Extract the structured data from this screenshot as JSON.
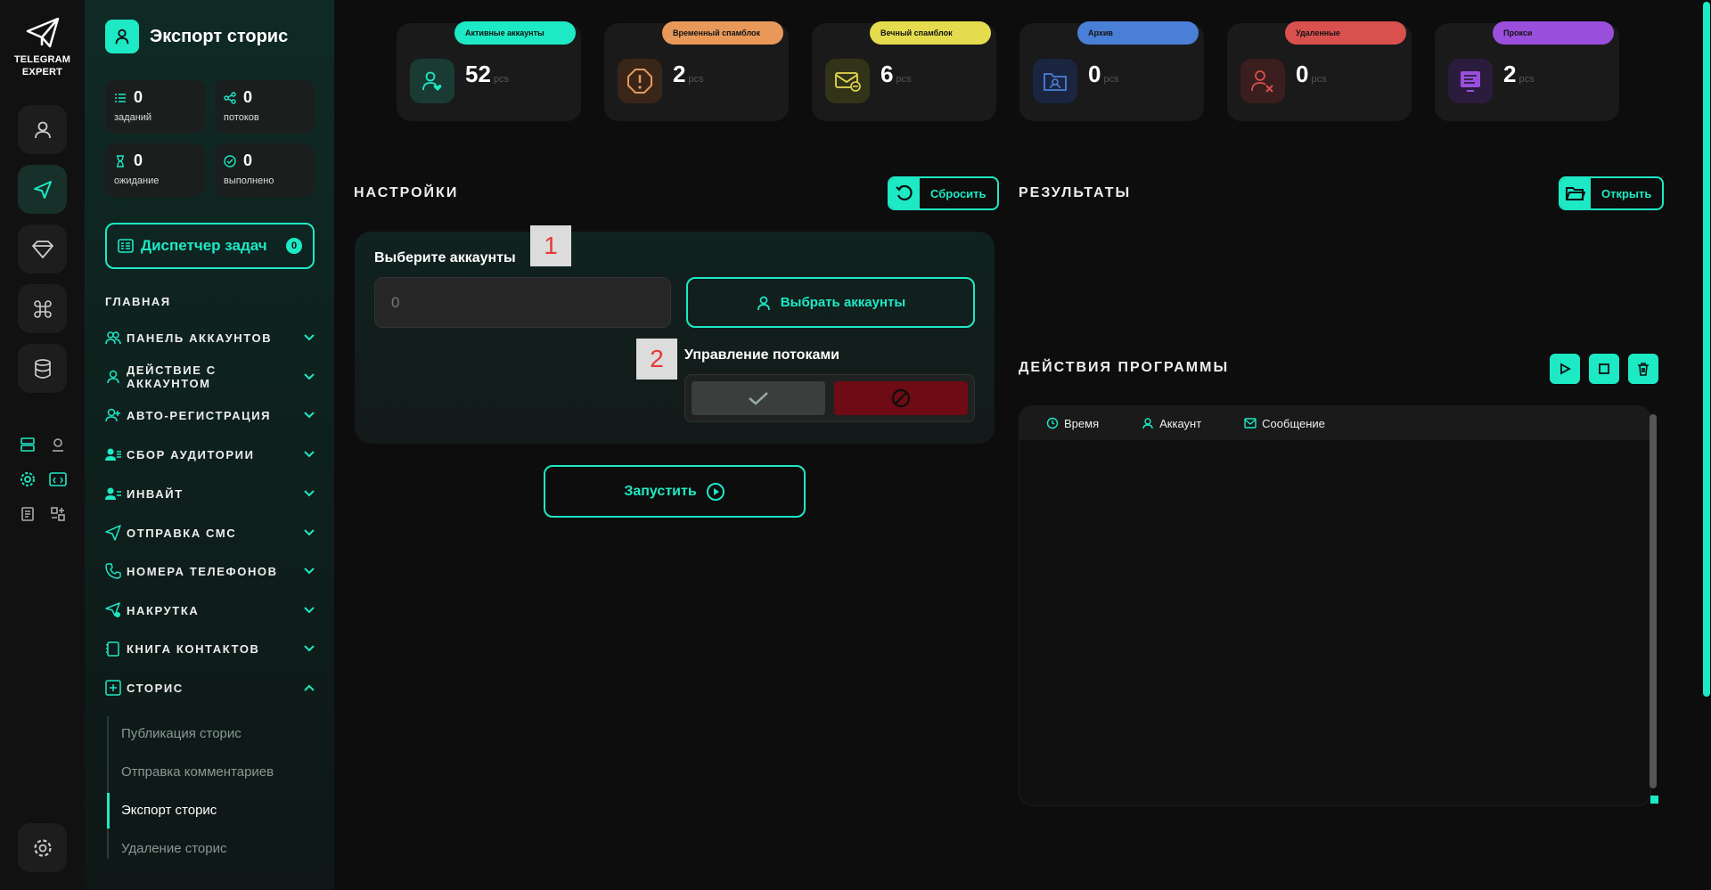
{
  "app": {
    "logo_line1": "TELEGRAM",
    "logo_line2": "EXPERT"
  },
  "header": {
    "title": "Экспорт сторис"
  },
  "stats": [
    {
      "value": "0",
      "label": "заданий"
    },
    {
      "value": "0",
      "label": "потоков"
    },
    {
      "value": "0",
      "label": "ожидание"
    },
    {
      "value": "0",
      "label": "выполнено"
    }
  ],
  "dispatcher": {
    "label": "Диспетчер задач",
    "count": "0"
  },
  "sidebar": {
    "section_title": "ГЛАВНАЯ",
    "items": [
      {
        "label": "ПАНЕЛЬ АККАУНТОВ"
      },
      {
        "label": "ДЕЙСТВИЕ С АККАУНТОМ"
      },
      {
        "label": "АВТО-РЕГИСТРАЦИЯ"
      },
      {
        "label": "СБОР АУДИТОРИИ"
      },
      {
        "label": "ИНВАЙТ"
      },
      {
        "label": "ОТПРАВКА СМС"
      },
      {
        "label": "НОМЕРА ТЕЛЕФОНОВ"
      },
      {
        "label": "НАКРУТКА"
      },
      {
        "label": "КНИГА КОНТАКТОВ"
      },
      {
        "label": "СТОРИС"
      }
    ],
    "sub_items": [
      {
        "label": "Публикация сторис"
      },
      {
        "label": "Отправка комментариев"
      },
      {
        "label": "Экспорт сторис"
      },
      {
        "label": "Удаление сторис"
      }
    ]
  },
  "cards": [
    {
      "badge": "Активные аккаунты",
      "value": "52",
      "unit": "pcs",
      "color": "#1de9c5"
    },
    {
      "badge": "Временный спамблок",
      "value": "2",
      "unit": "pcs",
      "color": "#e8995a"
    },
    {
      "badge": "Вечный спамблок",
      "value": "6",
      "unit": "pcs",
      "color": "#e4dc4e"
    },
    {
      "badge": "Архив",
      "value": "0",
      "unit": "pcs",
      "color": "#4a7fd8"
    },
    {
      "badge": "Удаленные",
      "value": "0",
      "unit": "pcs",
      "color": "#d9504e"
    },
    {
      "badge": "Прокси",
      "value": "2",
      "unit": "pcs",
      "color": "#9a4fdc"
    }
  ],
  "settings": {
    "title": "НАСТРОЙКИ",
    "reset_label": "Сбросить",
    "accounts_label": "Выберите аккаунты",
    "accounts_value": "0",
    "select_accounts_label": "Выбрать аккаунты",
    "threads_label": "Управление потоками",
    "step1": "1",
    "step2": "2",
    "run_label": "Запустить"
  },
  "results": {
    "title": "РЕЗУЛЬТАТЫ",
    "open_label": "Открыть"
  },
  "actions": {
    "title": "ДЕЙСТВИЯ ПРОГРАММЫ",
    "columns": [
      "Время",
      "Аккаунт",
      "Сообщение"
    ]
  },
  "colors": {
    "accent": "#1de9c5",
    "background": "#0d0d0d"
  }
}
